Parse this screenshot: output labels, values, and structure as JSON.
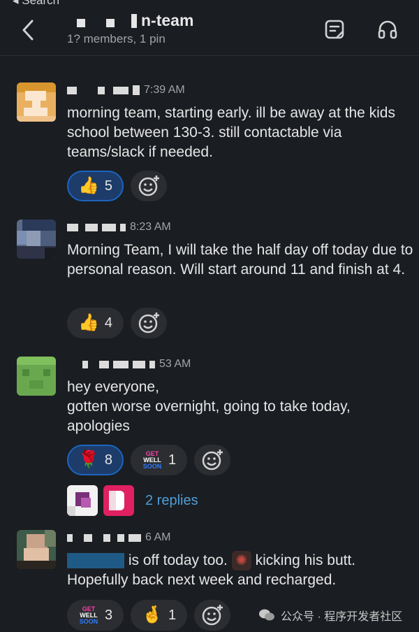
{
  "nav": {
    "back_label": "◂ Search"
  },
  "header": {
    "channel_name": "n-team",
    "subtitle": "1? members, 1 pin"
  },
  "messages": [
    {
      "time": "7:39 AM",
      "text": "morning team, starting early. ill be away at the kids school between 130-3. still contactable via teams/slack if needed.",
      "reactions": [
        {
          "emoji": "👍",
          "count": "5",
          "mine": true
        }
      ]
    },
    {
      "time": "8:23 AM",
      "text": "Morning Team, I will take the half day off today due to personal reason. Will start around 11 and finish at 4.",
      "reactions": [
        {
          "emoji": "👍",
          "count": "4",
          "mine": false
        }
      ]
    },
    {
      "time": "53 AM",
      "text_line1": "hey everyone,",
      "text_line2": "gotten worse overnight, going to take today, apologies",
      "reactions": [
        {
          "emoji": "🌹",
          "count": "8",
          "mine": true
        },
        {
          "emoji_text": [
            "GET",
            "WELL",
            "SOON"
          ],
          "count": "1",
          "mine": false
        }
      ],
      "replies_label": "2 replies"
    },
    {
      "time": "6 AM",
      "text_part1": "is off today too.",
      "text_part2": "kicking his butt.",
      "text_line2": "Hopefully back next week and recharged.",
      "reactions": [
        {
          "emoji_text": [
            "GET",
            "WELL",
            "SOON"
          ],
          "count": "3",
          "mine": false
        },
        {
          "emoji": "🤞",
          "count": "1",
          "mine": false
        }
      ]
    }
  ],
  "watermark": {
    "text": "公众号 · 程序开发者社区"
  },
  "icons": {
    "back": "chevron-left-icon",
    "canvas": "canvas-icon",
    "huddle": "headphones-icon",
    "add_reaction": "add-reaction-icon",
    "wechat": "wechat-icon"
  },
  "colors": {
    "background": "#1a1d21",
    "link": "#4f9ed8",
    "reaction_selected": "#1d3c6a"
  }
}
